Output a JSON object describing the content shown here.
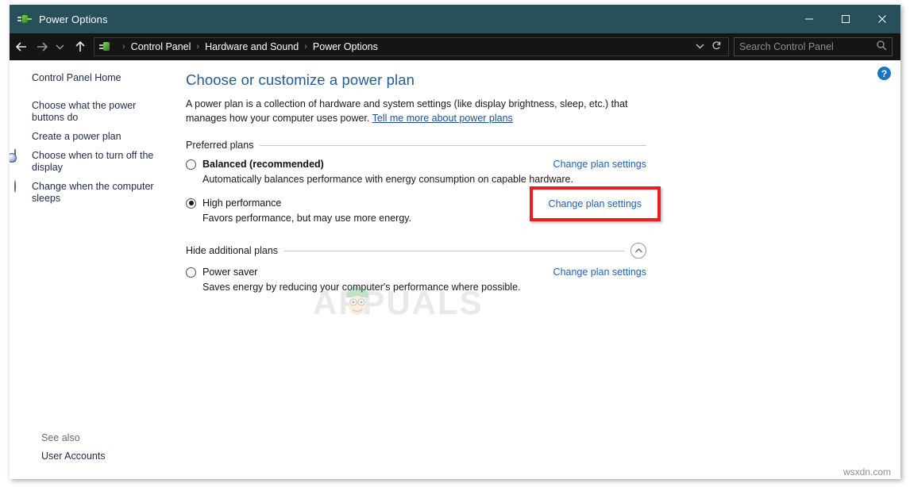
{
  "window": {
    "title": "Power Options",
    "app_icon": "power-plug-icon",
    "controls": {
      "minimize": "minimize-icon",
      "maximize": "maximize-icon",
      "close": "close-icon"
    },
    "titlebar_color": "#27505b"
  },
  "navbar": {
    "back": "back-arrow-icon",
    "forward": "forward-arrow-icon",
    "recent": "chevron-down-icon",
    "up": "up-arrow-icon",
    "breadcrumb": [
      "Control Panel",
      "Hardware and Sound",
      "Power Options"
    ],
    "breadcrumb_separator": "›",
    "dropdown": "chevron-down-icon",
    "refresh": "refresh-icon",
    "search": {
      "placeholder": "Search Control Panel",
      "value": "",
      "icon": "search-icon"
    }
  },
  "sidebar": {
    "home": "Control Panel Home",
    "items": [
      {
        "label": "Choose what the power buttons do",
        "icon": null
      },
      {
        "label": "Create a power plan",
        "icon": null
      },
      {
        "label": "Choose when to turn off the display",
        "icon": "monitor-clock-icon"
      },
      {
        "label": "Change when the computer sleeps",
        "icon": "moon-icon"
      }
    ],
    "see_also_label": "See also",
    "see_also_items": [
      "User Accounts"
    ]
  },
  "main": {
    "help_icon": "help-icon",
    "help_label": "?",
    "title": "Choose or customize a power plan",
    "description": "A power plan is a collection of hardware and system settings (like display brightness, sleep, etc.) that manages how your computer uses power. ",
    "description_link": "Tell me more about power plans",
    "preferred_plans_label": "Preferred plans",
    "hide_additional_label": "Hide additional plans",
    "collapse_icon": "chevron-up-icon",
    "change_link_label": "Change plan settings",
    "preferred_plans": [
      {
        "name": "Balanced (recommended)",
        "bold": true,
        "selected": false,
        "description": "Automatically balances performance with energy consumption on capable hardware.",
        "highlighted": false
      },
      {
        "name": "High performance",
        "bold": false,
        "selected": true,
        "description": "Favors performance, but may use more energy.",
        "highlighted": true
      }
    ],
    "additional_plans": [
      {
        "name": "Power saver",
        "bold": false,
        "selected": false,
        "description": "Saves energy by reducing your computer's performance where possible.",
        "highlighted": false
      }
    ]
  },
  "watermarks": {
    "center": "APPUALS",
    "bottom_right": "wsxdn.com"
  },
  "colors": {
    "accent_link": "#1a63b5",
    "title_blue": "#1f5c99",
    "highlight_red": "#ed1c24",
    "titlebar": "#27505b"
  }
}
